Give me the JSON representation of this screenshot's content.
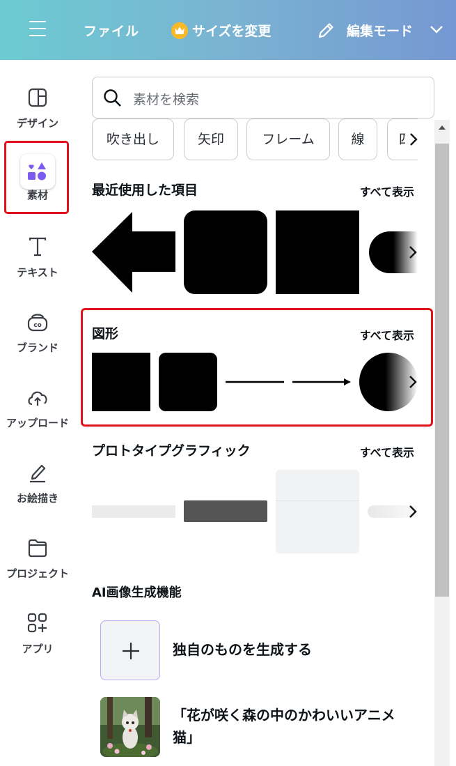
{
  "header": {
    "file_label": "ファイル",
    "resize_label": "サイズを変更",
    "edit_mode_label": "編集モード"
  },
  "sidebar": {
    "items": [
      {
        "label": "デザイン",
        "icon": "design-icon"
      },
      {
        "label": "素材",
        "icon": "elements-icon"
      },
      {
        "label": "テキスト",
        "icon": "text-icon"
      },
      {
        "label": "ブランド",
        "icon": "brand-icon"
      },
      {
        "label": "アップロード",
        "icon": "upload-icon"
      },
      {
        "label": "お絵描き",
        "icon": "draw-icon"
      },
      {
        "label": "プロジェクト",
        "icon": "folder-icon"
      },
      {
        "label": "アプリ",
        "icon": "apps-icon"
      }
    ],
    "active_index": 1
  },
  "search": {
    "placeholder": "素材を検索"
  },
  "chips": [
    "吹き出し",
    "矢印",
    "フレーム",
    "線",
    "四"
  ],
  "sections": {
    "recent": {
      "title": "最近使用した項目",
      "see_all": "すべて表示"
    },
    "shapes": {
      "title": "図形",
      "see_all": "すべて表示"
    },
    "prototype": {
      "title": "プロトタイプグラフィック",
      "see_all": "すべて表示"
    },
    "ai": {
      "title": "AI画像生成機能"
    }
  },
  "ai_items": [
    {
      "label": "独自のものを生成する"
    },
    {
      "label_line1": "「花が咲く森の中のかわいいアニメ",
      "label_line2": "猫」"
    }
  ],
  "colors": {
    "accent_purple": "#7d5bf0",
    "highlight_red": "#e0121c"
  }
}
